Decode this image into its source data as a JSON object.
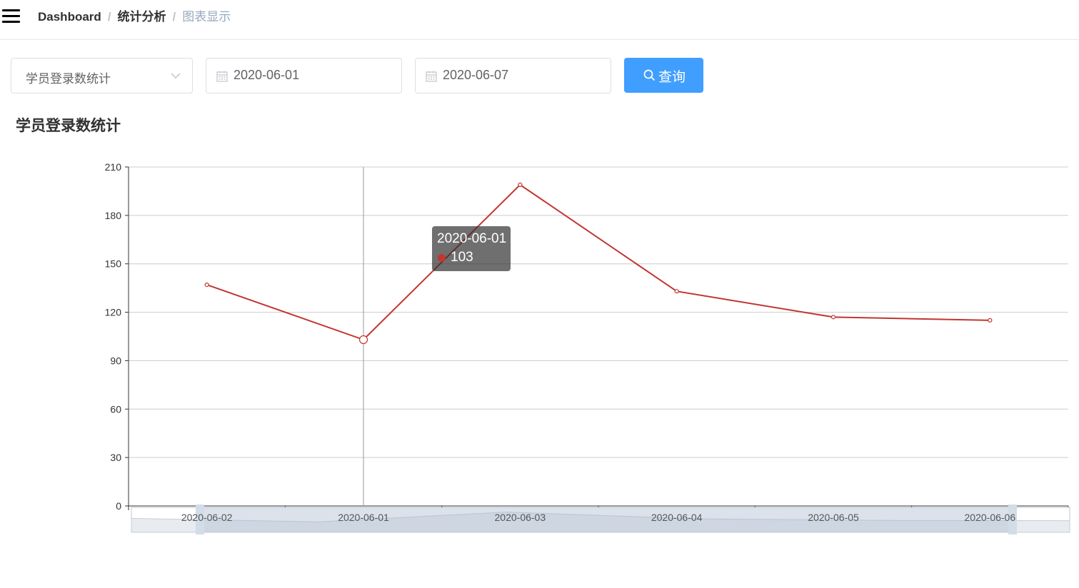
{
  "breadcrumb": [
    "Dashboard",
    "统计分析",
    "图表显示"
  ],
  "filters": {
    "stat_type": "学员登录数统计",
    "start_date": "2020-06-01",
    "end_date": "2020-06-07",
    "query_label": "查询"
  },
  "colors": {
    "accent": "#409eff",
    "series": "#c23531"
  },
  "icons": {
    "menu": "hamburger-icon",
    "dropdown": "chevron-down-icon",
    "date": "calendar-icon",
    "search": "search-icon"
  },
  "chart_data": {
    "type": "line",
    "title": "学员登录数统计",
    "categories": [
      "2020-06-02",
      "2020-06-01",
      "2020-06-03",
      "2020-06-04",
      "2020-06-05",
      "2020-06-06"
    ],
    "category_labels_shown": [
      "202",
      "-06-02",
      "2020-06-01",
      "2020-06-03",
      "2020-06-04",
      "2020-06-05",
      "2020-06-0",
      "5"
    ],
    "series": [
      {
        "values": [
          137,
          103,
          199,
          133,
          117,
          115
        ]
      }
    ],
    "ylim": [
      0,
      210
    ],
    "yticks": [
      0,
      30,
      60,
      90,
      120,
      150,
      180,
      210
    ],
    "grid": true,
    "tooltip": {
      "category": "2020-06-01",
      "value": "103"
    },
    "data_zoom": true
  }
}
